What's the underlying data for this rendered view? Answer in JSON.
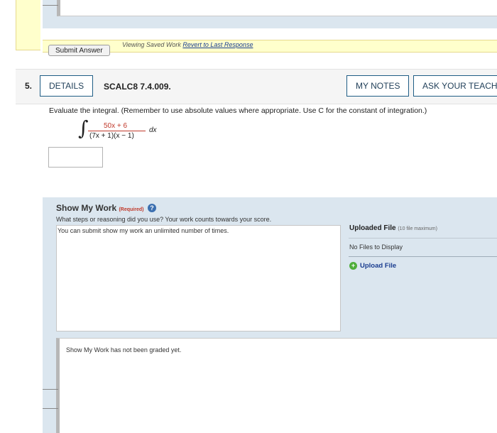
{
  "previous": {
    "submit_label": "Submit Answer",
    "saved_text": "Viewing Saved Work",
    "revert_link": "Revert to Last Response"
  },
  "question": {
    "number": "5.",
    "details_label": "DETAILS",
    "code": "SCALC8 7.4.009.",
    "my_notes_label": "MY NOTES",
    "ask_teacher_label": "ASK YOUR TEACHER",
    "prompt": "Evaluate the integral. (Remember to use absolute values where appropriate. Use C for the constant of integration.)",
    "integrand_numerator": "50x + 6",
    "integrand_denominator": "(7x + 1)(x − 1)",
    "differential": "dx",
    "answer_value": ""
  },
  "show_my_work": {
    "title": "Show My Work",
    "required_label": "(Required)",
    "help_icon": "question-circle-icon",
    "subtitle": "What steps or reasoning did you use? Your work counts towards your score.",
    "textarea_text": "You can submit show my work an unlimited number of times.",
    "uploaded_title": "Uploaded File",
    "uploaded_max": "(10 file maximum)",
    "no_files": "No Files to Display",
    "upload_icon": "plus-circle-icon",
    "upload_label": "Upload File",
    "graded_text": "Show My Work has not been graded yet."
  },
  "colors": {
    "accent_blue": "#1f5d85",
    "panel_blue": "#dbe6ef",
    "saved_yellow": "#ffffcc",
    "numerator_red": "#c0392b"
  }
}
